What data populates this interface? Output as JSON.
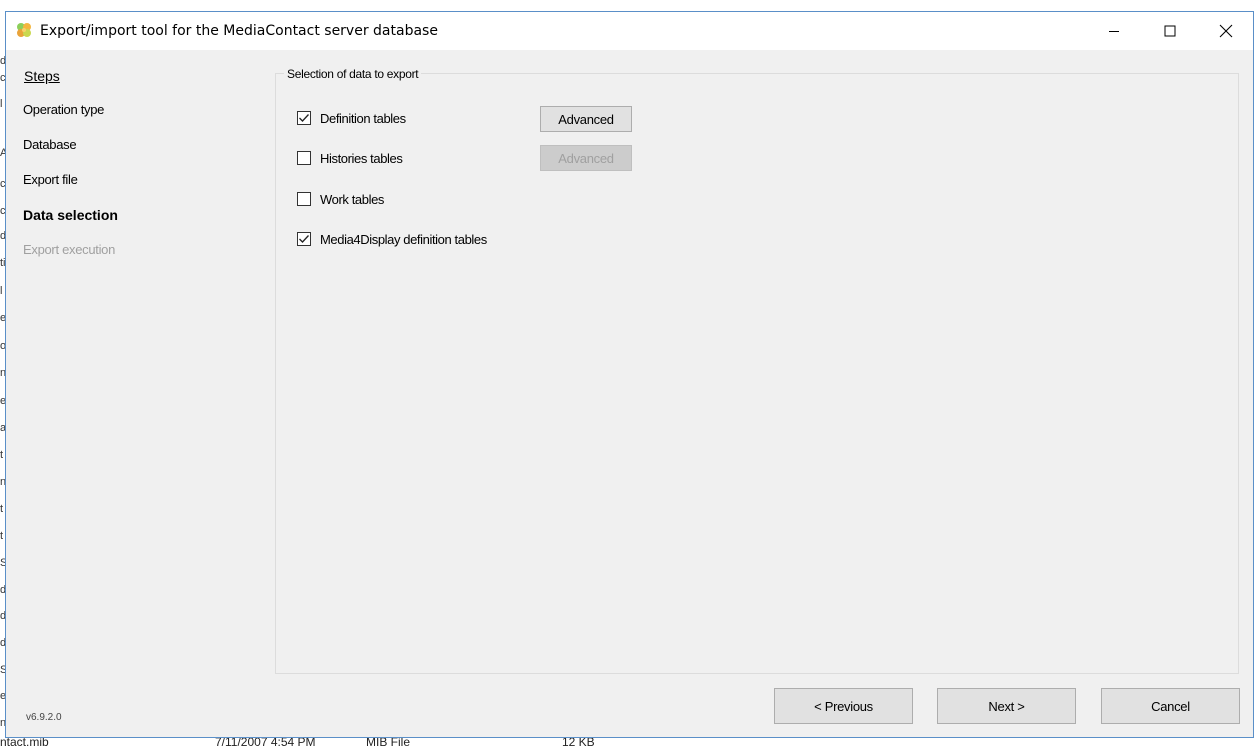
{
  "window": {
    "title": "Export/import tool for the MediaContact server database",
    "controls": {
      "minimize": "minimize",
      "maximize": "maximize",
      "close": "close"
    }
  },
  "sidebar": {
    "header": "Steps",
    "items": [
      {
        "label": "Operation type",
        "state": "normal"
      },
      {
        "label": "Database",
        "state": "normal"
      },
      {
        "label": "Export file",
        "state": "normal"
      },
      {
        "label": "Data selection",
        "state": "active"
      },
      {
        "label": "Export execution",
        "state": "disabled"
      }
    ],
    "version": "v6.9.2.0"
  },
  "main": {
    "group_title": "Selection of data to export",
    "options": [
      {
        "label": "Definition tables",
        "checked": true,
        "advanced_label": "Advanced",
        "advanced_enabled": true
      },
      {
        "label": "Histories tables",
        "checked": false,
        "advanced_label": "Advanced",
        "advanced_enabled": false
      },
      {
        "label": "Work tables",
        "checked": false
      },
      {
        "label": "Media4Display definition tables",
        "checked": true
      }
    ]
  },
  "footer": {
    "previous_label": "< Previous",
    "next_label": "Next >",
    "cancel_label": "Cancel"
  },
  "background": {
    "file_row": {
      "name": "ntact.mib",
      "modified": "7/11/2007 4:54 PM",
      "type": "MIB File",
      "size": "12 KB"
    },
    "left_edge_chars": [
      "d",
      "c",
      "l",
      "A",
      "c",
      "c",
      "d",
      "ti",
      "l",
      "e",
      "o",
      "n",
      "e",
      "a",
      "t",
      "n",
      "t",
      "t",
      "S",
      "d",
      "d",
      "d",
      "S",
      "e",
      "n"
    ]
  },
  "colors": {
    "window_bg": "#f0f0f0",
    "titlebar_bg": "#ffffff",
    "window_border": "#5a8fc8",
    "disabled_text": "#a0a0a0"
  }
}
